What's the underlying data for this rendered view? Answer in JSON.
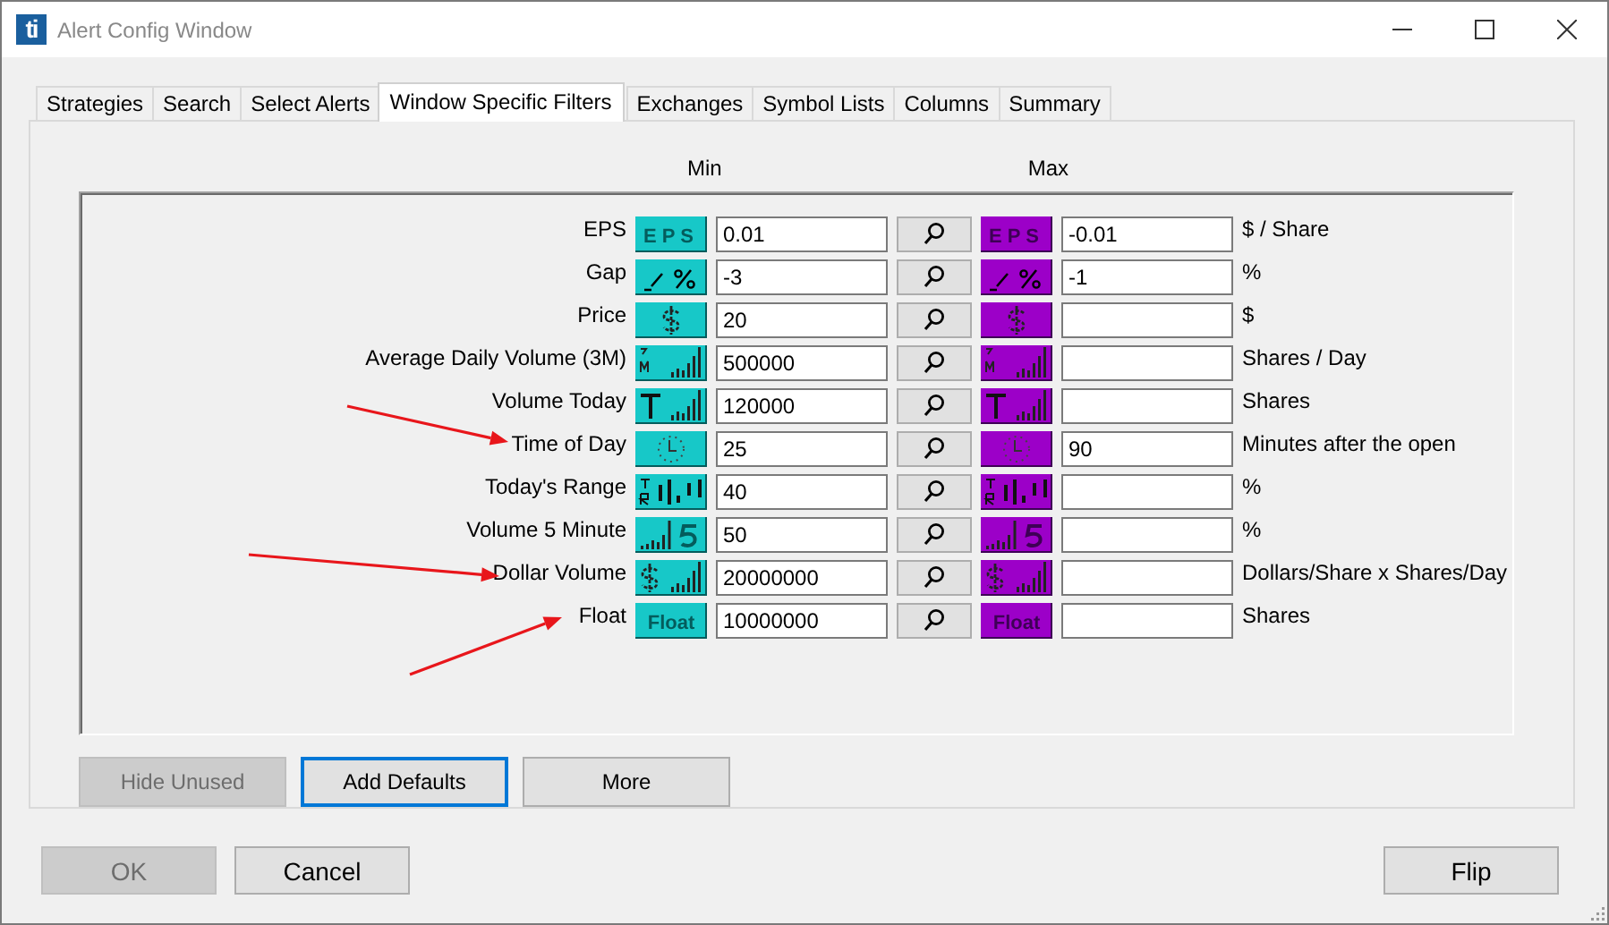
{
  "window": {
    "logo_text": "ti",
    "title": "Alert Config Window"
  },
  "tabs": [
    {
      "label": "Strategies",
      "selected": false
    },
    {
      "label": "Search",
      "selected": false
    },
    {
      "label": "Select Alerts",
      "selected": false
    },
    {
      "label": "Window Specific Filters",
      "selected": true
    },
    {
      "label": "Exchanges",
      "selected": false
    },
    {
      "label": "Symbol Lists",
      "selected": false
    },
    {
      "label": "Columns",
      "selected": false
    },
    {
      "label": "Summary",
      "selected": false
    }
  ],
  "headers": {
    "min": "Min",
    "max": "Max"
  },
  "filters": [
    {
      "label": "EPS",
      "kind": "eps",
      "min_icon_text": "EPS",
      "max_icon_text": "EPS",
      "min": "0.01",
      "max": "-0.01",
      "unit": "$ / Share"
    },
    {
      "label": "Gap",
      "kind": "gap",
      "min": "-3",
      "max": "-1",
      "unit": "%"
    },
    {
      "label": "Price",
      "kind": "price",
      "min": "20",
      "unit": "$"
    },
    {
      "label": "Average Daily Volume (3M)",
      "kind": "avgvol",
      "min": "500000",
      "unit": "Shares / Day"
    },
    {
      "label": "Volume Today",
      "kind": "voltoday",
      "min": "120000",
      "unit": "Shares"
    },
    {
      "label": "Time of Day",
      "kind": "time",
      "min": "25",
      "max": "90",
      "unit": "Minutes after the open"
    },
    {
      "label": "Today's Range",
      "kind": "range",
      "min": "40",
      "unit": "%"
    },
    {
      "label": "Volume 5 Minute",
      "kind": "vol5",
      "min": "50",
      "unit": "%"
    },
    {
      "label": "Dollar Volume",
      "kind": "dollarvol",
      "min": "20000000",
      "unit": "Dollars/Share x Shares/Day"
    },
    {
      "label": "Float",
      "kind": "float",
      "min_icon_text": "Float",
      "max_icon_text": "Float",
      "min": "10000000",
      "unit": "Shares"
    }
  ],
  "panel_buttons": [
    {
      "label": "Hide Unused",
      "disabled": true,
      "focused": false
    },
    {
      "label": "Add Defaults",
      "disabled": false,
      "focused": true
    },
    {
      "label": "More",
      "disabled": false,
      "focused": false
    }
  ],
  "dialog_buttons": [
    {
      "label": "OK",
      "disabled": true
    },
    {
      "label": "Cancel",
      "disabled": false
    }
  ],
  "right_dialog_buttons": [
    {
      "label": "Flip",
      "disabled": false
    }
  ]
}
